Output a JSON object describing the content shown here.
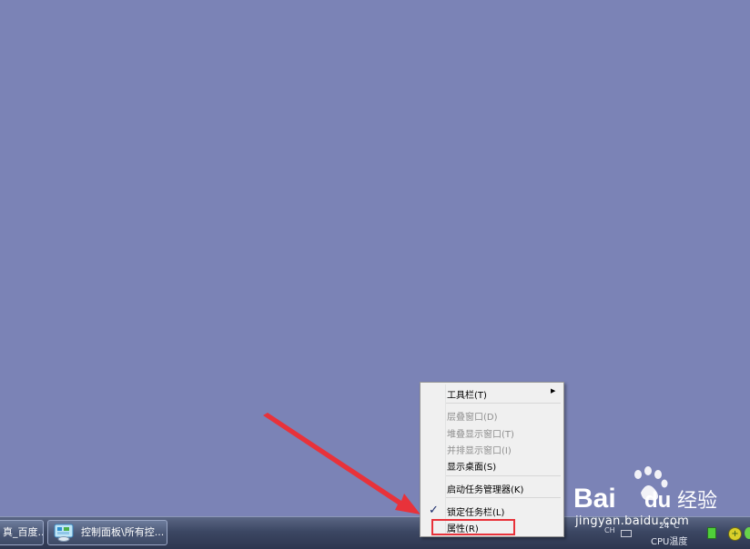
{
  "context_menu": {
    "items": [
      {
        "label": "工具栏(T)",
        "enabled": true,
        "submenu": true
      },
      {
        "label": "层叠窗口(D)",
        "enabled": false
      },
      {
        "label": "堆叠显示窗口(T)",
        "enabled": false
      },
      {
        "label": "并排显示窗口(I)",
        "enabled": false
      },
      {
        "label": "显示桌面(S)",
        "enabled": true
      },
      {
        "label": "启动任务管理器(K)",
        "enabled": true
      },
      {
        "label": "锁定任务栏(L)",
        "enabled": true,
        "checked": true
      },
      {
        "label": "属性(R)",
        "enabled": true,
        "highlighted": true
      }
    ],
    "highlight_color": "#e8323a"
  },
  "taskbar": {
    "buttons": [
      {
        "label": "真_百度..."
      },
      {
        "label": "控制面板\\所有控..."
      }
    ],
    "tray": {
      "small_text": "CH",
      "temperature": "24°C",
      "cpu_label": "CPU温度"
    }
  },
  "watermark": {
    "logo_text": "Bai",
    "logo_text2": "du",
    "suffix": "经验",
    "url": "jingyan.baidu.com"
  },
  "colors": {
    "desktop": "#7b83b6",
    "annotation_arrow": "#e8323a"
  }
}
